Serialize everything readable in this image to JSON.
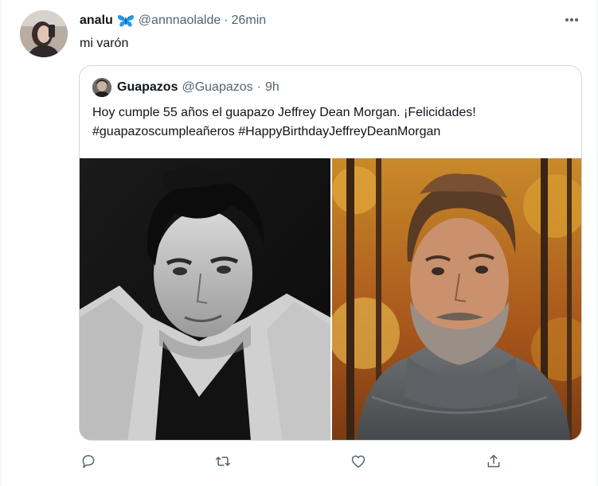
{
  "tweet": {
    "author_name": "analu",
    "author_handle": "@annnaolalde",
    "separator": "·",
    "time": "26min",
    "text": "mi varón",
    "more_icon": "more-horizontal-icon",
    "emoji_icon": "butterfly-icon"
  },
  "quote": {
    "author_name": "Guapazos",
    "author_handle": "@Guapazos",
    "separator": "·",
    "time": "9h",
    "text_line1": "Hoy cumple 55 años el guapazo Jeffrey Dean Morgan. ¡Felicidades!",
    "text_line2": "#guapazoscumpleañeros #HappyBirthdayJeffreyDeanMorgan"
  },
  "actions": [
    {
      "icon": "reply-icon"
    },
    {
      "icon": "retweet-icon"
    },
    {
      "icon": "like-icon"
    },
    {
      "icon": "share-icon"
    }
  ],
  "colors": {
    "text_primary": "#0f1419",
    "text_secondary": "#536471",
    "border": "#cfd9de",
    "butterfly": "#1d9bf0"
  }
}
